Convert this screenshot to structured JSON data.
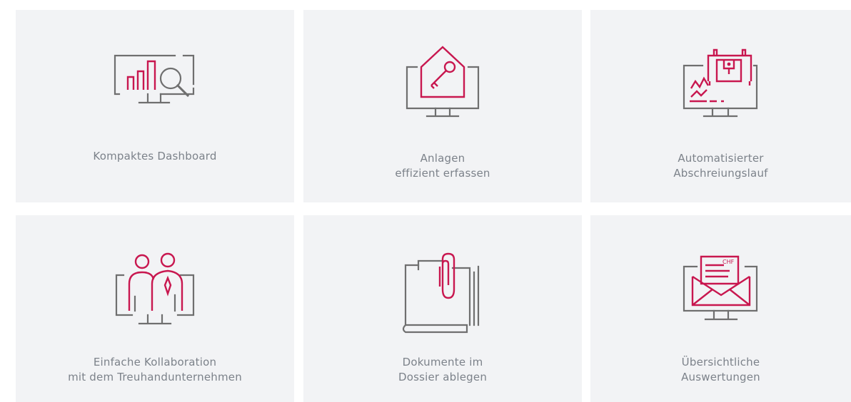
{
  "cards": [
    {
      "lines": [
        "Kompaktes Dashboard"
      ],
      "icon": "dashboard-chart-icon"
    },
    {
      "lines": [
        "Anlagen",
        "effizient erfassen"
      ],
      "icon": "house-key-icon"
    },
    {
      "lines": [
        "Automatisierter",
        "Abschreiungslauf"
      ],
      "icon": "machine-depreciation-icon"
    },
    {
      "lines": [
        "Einfache Kollaboration",
        "mit dem Treuhandunternehmen"
      ],
      "icon": "collaboration-people-icon"
    },
    {
      "lines": [
        "Dokumente im",
        "Dossier ablegen"
      ],
      "icon": "document-clip-icon"
    },
    {
      "lines": [
        "Übersichtliche",
        "Auswertungen"
      ],
      "icon": "report-envelope-icon"
    }
  ],
  "icon_text": {
    "currency": "CHF"
  },
  "colors": {
    "accent": "#c8174f",
    "outline": "#6f6f6f",
    "card_bg": "#f2f3f5",
    "text": "#7c828a"
  }
}
